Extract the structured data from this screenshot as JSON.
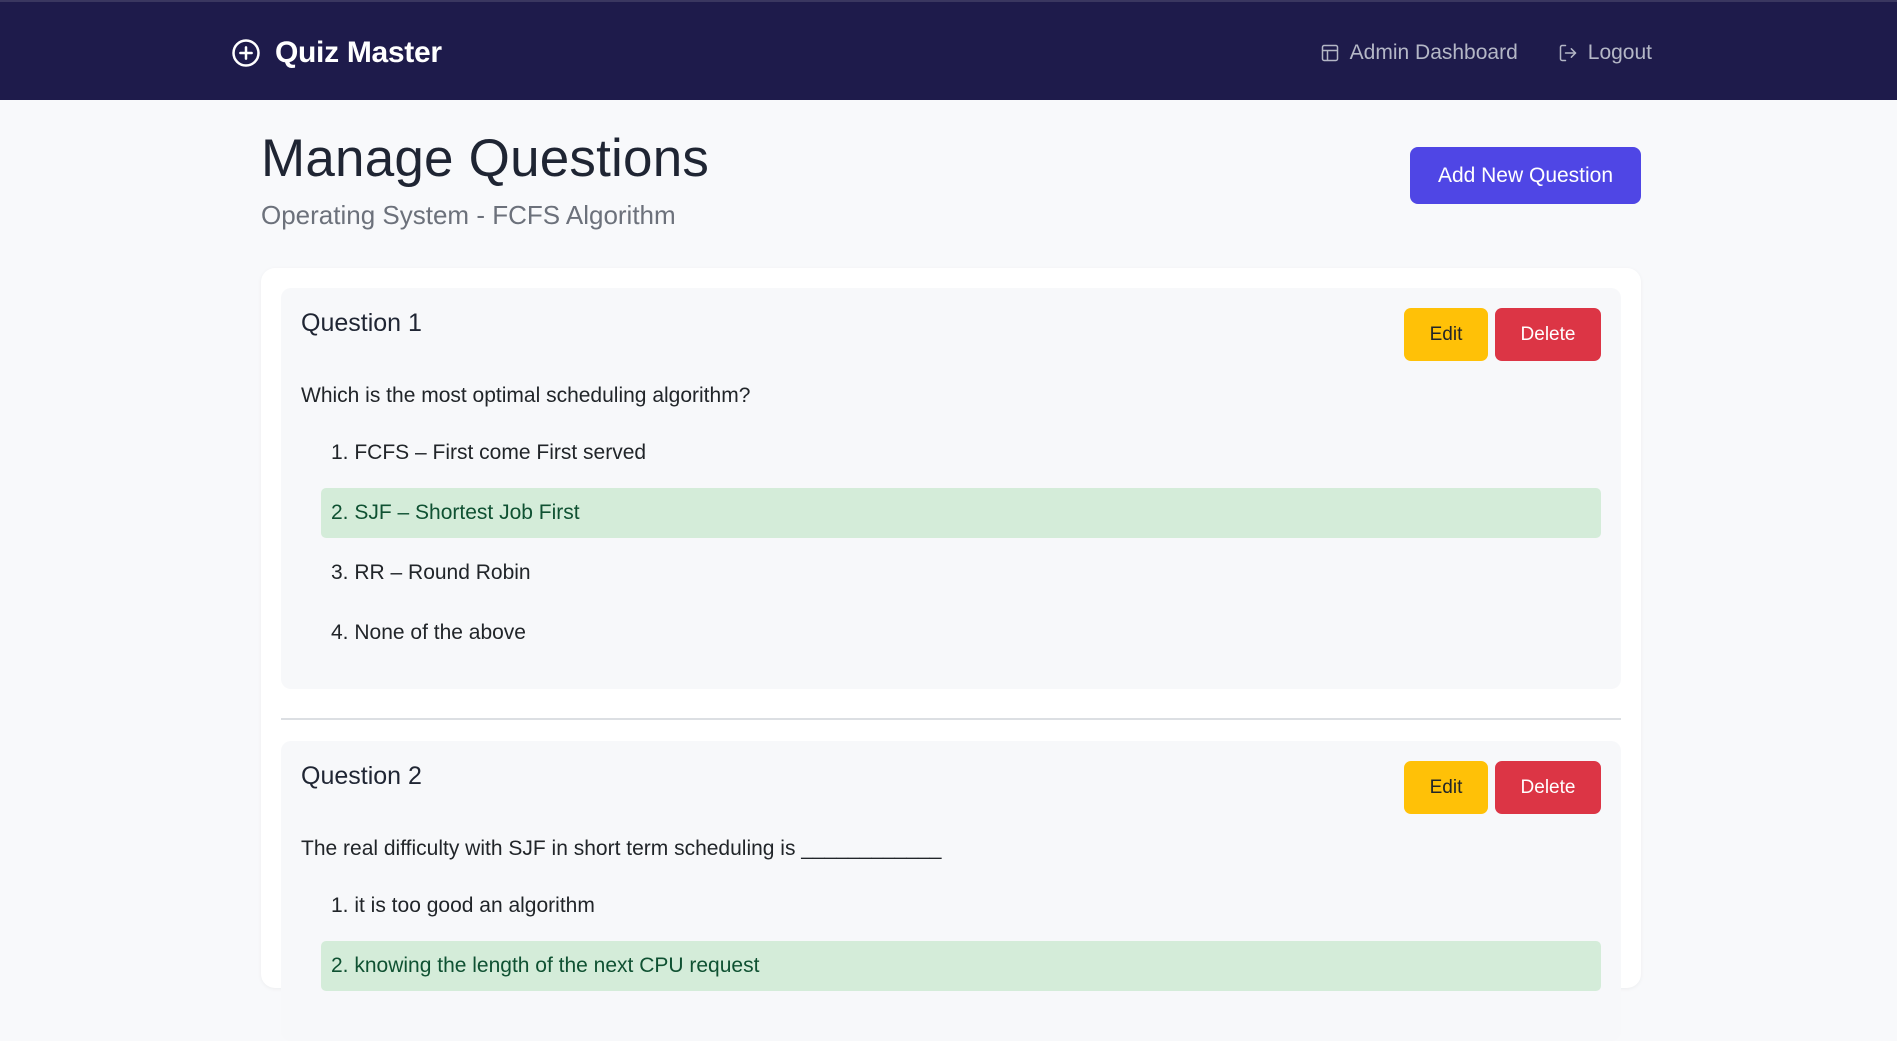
{
  "navbar": {
    "brand": "Quiz Master",
    "links": [
      {
        "label": "Admin Dashboard",
        "icon": "dashboard-icon"
      },
      {
        "label": "Logout",
        "icon": "logout-icon"
      }
    ]
  },
  "header": {
    "title": "Manage Questions",
    "subtitle": "Operating System - FCFS Algorithm",
    "add_button": "Add New Question"
  },
  "actions": {
    "edit": "Edit",
    "delete": "Delete"
  },
  "questions": [
    {
      "title": "Question 1",
      "text": "Which is the most optimal scheduling algorithm?",
      "options": [
        "1. FCFS – First come First served",
        "2. SJF – Shortest Job First",
        "3. RR – Round Robin",
        "4. None of the above"
      ],
      "correct_index": 1
    },
    {
      "title": "Question 2",
      "text": "The real difficulty with SJF in short term scheduling is ____________",
      "options": [
        "1. it is too good an algorithm",
        "2. knowing the length of the next CPU request"
      ],
      "correct_index": 1
    }
  ],
  "colors": {
    "navbar_bg": "#1e1b4b",
    "primary": "#4f46e5",
    "edit": "#ffc107",
    "delete": "#dc3545",
    "correct_bg": "#d4ecd9",
    "correct_text": "#0f5132"
  }
}
